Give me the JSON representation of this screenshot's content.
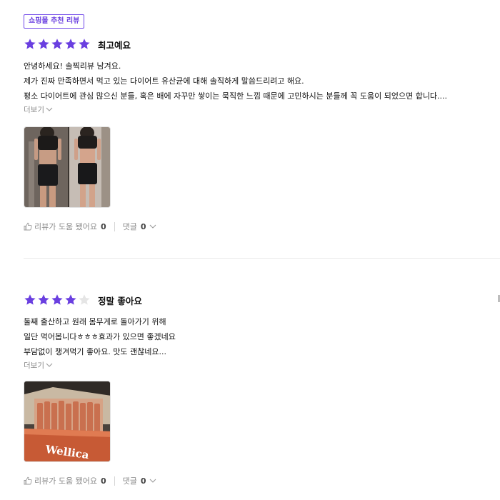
{
  "badge": "쇼핑몰 추천 리뷰",
  "colors": {
    "accent": "#7048e8",
    "star_on": "#6a3fe0",
    "star_off": "#e5e5e5"
  },
  "reviews": [
    {
      "rating": 5,
      "rating_title": "최고예요",
      "lines": [
        "안녕하세요! 솔찍리뷰 남겨요.",
        "제가 진짜 만족하면서 먹고 있는 다이어트 유산균에 대해 솔직하게 말씀드리려고 해요.",
        "평소 다이어트에 관심 많으신 분들, 혹은 배에 자꾸만 쌓이는 묵직한 느낌 때문에 고민하시는 분들께 꼭 도움이 되었으면 합니다...."
      ],
      "more_label": "더보기",
      "helpful_label": "리뷰가 도움 됐어요",
      "helpful_count": "0",
      "comment_label": "댓글",
      "comment_count": "0"
    },
    {
      "rating": 4,
      "rating_title": "정말 좋아요",
      "lines": [
        "둘째 출산하고 원래 몸무게로 돌아가기 위해",
        "일단 먹어봅니다ㅎㅎㅎ효과가 있으면 좋겠네요",
        "부담없이 챙겨먹기 좋아요. 맛도 괜찮네요..."
      ],
      "more_label": "더보기",
      "photo_label": "Wellica",
      "helpful_label": "리뷰가 도움 됐어요",
      "helpful_count": "0",
      "comment_label": "댓글",
      "comment_count": "0"
    }
  ]
}
